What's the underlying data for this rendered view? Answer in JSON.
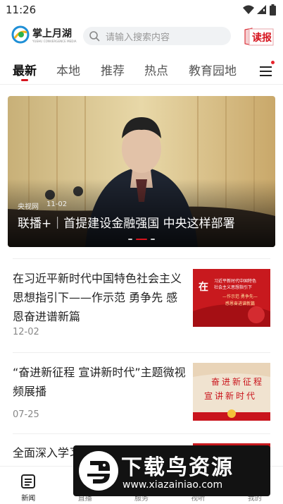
{
  "status_bar": {
    "time": "11:26"
  },
  "header": {
    "logo_title": "掌上月湖",
    "logo_subtitle": "YUEHU CONVERGENCE MEDIA",
    "search_placeholder": "请输入搜索内容",
    "read_label": "读报"
  },
  "tabs": [
    "最新",
    "本地",
    "推荐",
    "热点",
    "教育园地"
  ],
  "banner": {
    "source": "央视网",
    "date": "11-02",
    "title": "联播+｜首提建设金融强国 中央这样部署"
  },
  "news": [
    {
      "title": "在习近平新时代中国特色社会主义思想指引下——作示范 勇争先 感恩奋进谱新篇",
      "date": "12-02",
      "thumb_line1": "习近平新时代中国特色",
      "thumb_line2": "社会主义思想指引下",
      "thumb_line3": "—作示范 勇争先—",
      "thumb_line4": "感恩奋进谱新篇"
    },
    {
      "title": "“奋进新征程 宣讲新时代”主题微视频展播",
      "date": "07-25",
      "thumb_line1": "奋进新征程",
      "thumb_line2": "宣讲新时代"
    },
    {
      "title": "全面深入学习贯彻党的二十大精神",
      "date": ""
    }
  ],
  "bottom_nav": [
    "新闻",
    "直播",
    "服务",
    "视听",
    "我的"
  ],
  "watermark": {
    "title": "下载鸟资源",
    "url": "www.xiazainiao.com"
  },
  "colors": {
    "brand_red": "#d6141e",
    "text": "#222222",
    "muted": "#888888"
  }
}
